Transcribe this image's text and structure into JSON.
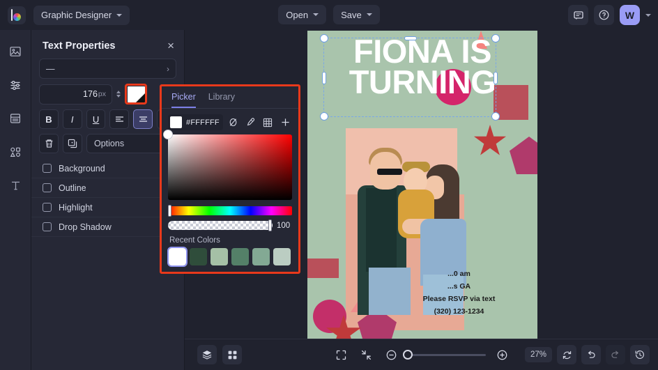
{
  "topbar": {
    "logo_name": "app-logo",
    "workspace": {
      "label": "Graphic Designer"
    },
    "open": {
      "label": "Open"
    },
    "save": {
      "label": "Save"
    },
    "avatar_initial": "W"
  },
  "rail": {
    "items": [
      {
        "name": "image-icon",
        "label": "Images"
      },
      {
        "name": "sliders-icon",
        "label": "Adjustments"
      },
      {
        "name": "page-layout-icon",
        "label": "Layout"
      },
      {
        "name": "shapes-icon",
        "label": "Shapes"
      },
      {
        "name": "text-icon",
        "label": "Text"
      }
    ]
  },
  "panel": {
    "title": "Text Properties",
    "close_label": "×",
    "font": {
      "value": "—",
      "arrow": "›"
    },
    "font_size": {
      "value": "176",
      "unit": "px"
    },
    "format": {
      "bold": "B",
      "italic": "I",
      "underline": "U",
      "align_left": "≡",
      "align_center": "≡",
      "align_right": "≡"
    },
    "actions": {
      "delete": "delete-icon",
      "duplicate": "duplicate-icon",
      "options": "Options"
    },
    "toggles": [
      {
        "label": "Background",
        "checked": false
      },
      {
        "label": "Outline",
        "checked": false
      },
      {
        "label": "Highlight",
        "checked": false
      },
      {
        "label": "Drop Shadow",
        "checked": false
      }
    ]
  },
  "picker": {
    "tabs": [
      {
        "label": "Picker",
        "active": true
      },
      {
        "label": "Library",
        "active": false
      }
    ],
    "hex": "#FFFFFF",
    "tools": [
      {
        "name": "no-color-icon"
      },
      {
        "name": "eyedropper-icon"
      },
      {
        "name": "grid-icon"
      },
      {
        "name": "add-icon"
      }
    ],
    "alpha": "100",
    "recent_label": "Recent Colors",
    "recent_colors": [
      "#FFFFFF",
      "#2F4D3B",
      "#A5C0A6",
      "#548068",
      "#83A994",
      "#BBCDC2"
    ],
    "highlight_color": "#E8391B"
  },
  "canvas": {
    "document": {
      "background": "#A9C4AC",
      "headline": "FIONA IS TURNING",
      "details": [
        "...0 am",
        "...s GA",
        "Please RSVP via text",
        "(320) 123-1234"
      ]
    }
  },
  "bottombar": {
    "layers": "layers-icon",
    "grid": "grid-view-icon",
    "fit_screen": "fit-to-screen-icon",
    "shrink": "shrink-to-fit-icon",
    "zoom_out": "zoom-out-icon",
    "zoom_in": "zoom-in-icon",
    "zoom_level": "27%",
    "reset": "reset-icon",
    "undo": "undo-icon",
    "redo": "redo-icon",
    "history": "history-icon"
  }
}
